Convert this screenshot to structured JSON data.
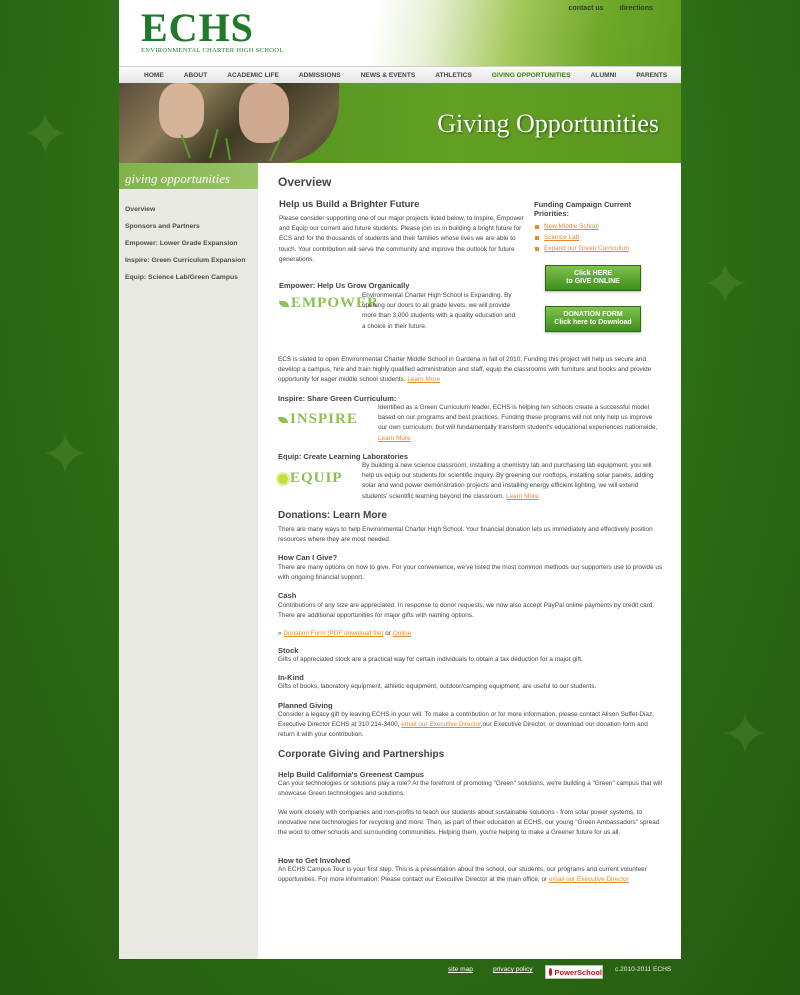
{
  "header": {
    "logo_main": "ECHS",
    "logo_sub": "ENVIRONMENTAL CHARTER HIGH SCHOOL",
    "top_links": [
      "contact us",
      "directions"
    ]
  },
  "nav": [
    "HOME",
    "ABOUT",
    "ACADEMIC LIFE",
    "ADMISSIONS",
    "NEWS & EVENTS",
    "ATHLETICS",
    "GIVING OPPORTUNITIES",
    "ALUMNI",
    "PARENTS"
  ],
  "banner": {
    "title": "Giving Opportunities"
  },
  "sidebar": {
    "title": "giving opportunities",
    "items": [
      "Overview",
      "Sponsors and Partners",
      "Empower: Lower Grade Expansion",
      "Inspire: Green Curriculum Expansion",
      "Equip: Science Lab/Green Campus"
    ]
  },
  "content": {
    "page_title": "Overview",
    "intro_title": "Help us Build a Brighter Future",
    "intro_text": "Please consider supporting one of our major projects listed below, to Inspire, Empower and Equip our current and future students.  Please join us in building a bright future for ECS and for the thousands of students and their families whose lives we are able to touch. Your contribution will serve the community and improve the outlook for future generations.",
    "funding": {
      "title": "Funding Campaign Current Priorities:",
      "items": [
        "New Middle School",
        "Science Lab",
        "Expand our Green Curriculum"
      ],
      "give_btn_line1": "Click HERE",
      "give_btn_line2": "to GIVE ONLINE",
      "form_btn_line1": "DONATION FORM",
      "form_btn_line2": "Click here to Download"
    },
    "empower": {
      "title": "Empower: Help Us Grow Organically",
      "logo": "EMPOWER",
      "text": "Environmental Charter High School is Expanding. By opening our doors to all grade levels, we will provide more than 3,000 students with a quality education and a choice in their future.",
      "text2": "ECS is slated to open Environmental Charter Middle School in Gardena in fall of 2010. Funding this project will help us secure and develop a campus, hire and train highly qualified administration and staff, equip the classrooms with furniture and books and provide opportunity for eager middle school students.",
      "learn_more": "Learn More"
    },
    "inspire": {
      "title": "Inspire: Share Green Curriculum:",
      "logo": "INSPIRE",
      "text": "Identified as a Green Curriculum leader, ECHS is helping ten schools create a successful model based on our programs and best practices. Funding these programs will not only help us improve our own curriculum, but will fundamentally transform student's educational experiences nationwide,",
      "learn_more": "Learn More"
    },
    "equip": {
      "title": "Equip: Create Learning Laboratories",
      "logo": "EQUIP",
      "text": "By building a new science classroom, installing a chemistry lab and purchasing lab equipment, you will help us equip our students for scientific inquiry.  By greening our rooftops, installing solar panels, adding solar and wind power demonstration projects and installing energy efficient lighting, we will extend students' scientific learning beyond the classroom.",
      "learn_more": "Learn More"
    },
    "donations": {
      "title": "Donations: Learn More",
      "intro": "There are many ways to help Environmental Charter High School.  Your financial donation lets us immediately and effectively position resources where they are most needed.",
      "how_title": "How Can I Give?",
      "how_text": "There are many options on how to give. For your convenience, we've listed the most common methods our supporters use to provide us with ongoing financial support.",
      "cash_title": "Cash",
      "cash_text": "Contributions of any size are appreciated. In response to donor requests, we now also accept PayPal online payments by credit card.  There are additional opportunities for major gifts with naming options.",
      "cash_prefix": "»",
      "cash_link1": "Donation Form (PDF download file)",
      "cash_or": "or",
      "cash_link2": "Online",
      "stock_title": "Stock",
      "stock_text": "Gifts of appreciated stock are a practical way for certain individuals to obtain a tax deduction for a major gift.",
      "inkind_title": "In-Kind",
      "inkind_text": "Gifts of books, laboratory equipment, athletic equipment, outdoor/camping equipment, are useful to our students.",
      "planned_title": "Planned Giving",
      "planned_text1": "Consider a legacy gift by leaving ECHS in your will.   To make a contribution or for more information, please contact Alison Suffet-Diaz, Executive Director ECHS at 310 214-3400,",
      "planned_link": "email our Executive Director",
      "planned_text2": ",our Executive Director, or download our donation form and return it with your contribution."
    },
    "corporate": {
      "title": "Corporate Giving and Partnerships",
      "help_title": "Help Build California's Greenest Campus",
      "help_text": "Can your technologies or solutions play a role?  At the forefront of promoting \"Green\" solutions, we're building a \"Green\" campus that will showcase Green technologies and solutions.",
      "work_text": "We work closely with companies and non-profits to teach our students about sustainable solutions - from solar power systems, to innovative new technologies for recycling and more.   Then, as part of their education at ECHS, our young \"Green Ambassadors\" spread the word to other schools and surrounding communities. Helping them, you're helping to make a Greener future for us all.",
      "involved_title": "How to Get Involved",
      "involved_text": "An ECHS Campus Tour is your first step. This is a presentation about the school, our students, our programs and current volunteer opportunities.   For more information: Please contact our Executive Director at the main office, or",
      "involved_link": "email our Executive Director"
    }
  },
  "footer": {
    "site_map": "site map",
    "privacy": "privacy policy",
    "powerschool": "PowerSchool",
    "copyright": "c.2010-2011 ECHS"
  }
}
